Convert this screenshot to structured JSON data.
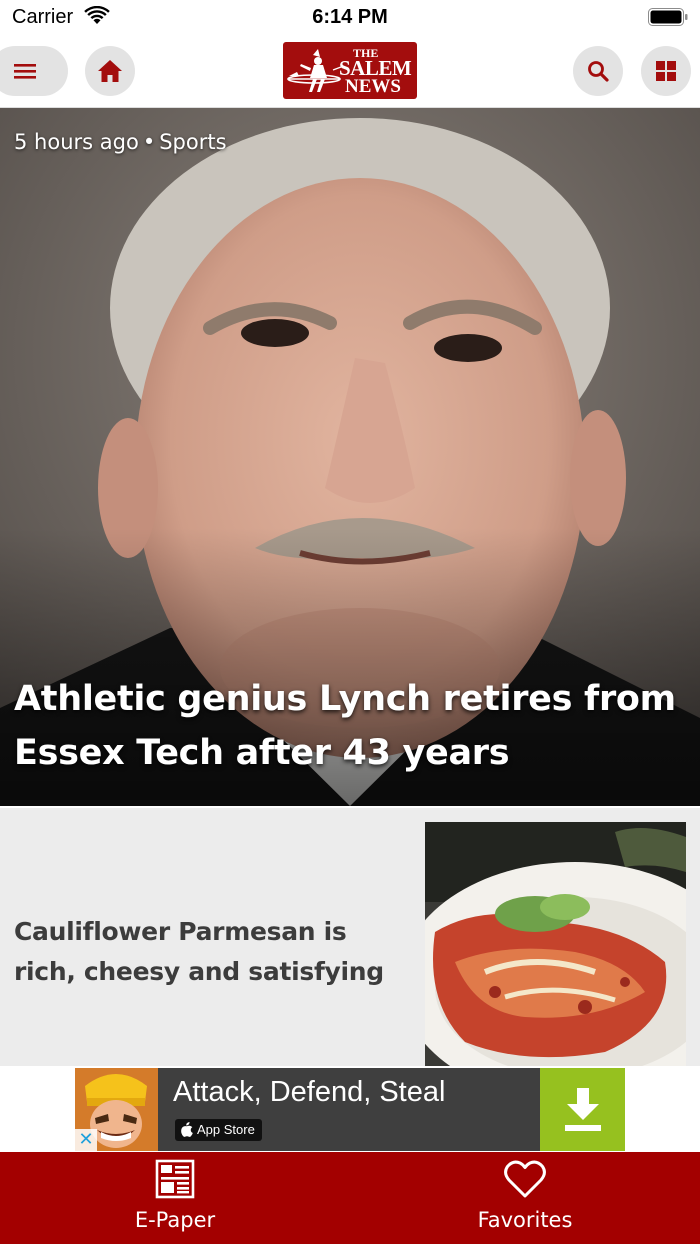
{
  "status_bar": {
    "carrier": "Carrier",
    "time": "6:14 PM"
  },
  "header": {
    "logo": {
      "line1": "THE",
      "line2": "SALEM",
      "line3": "NEWS"
    },
    "icons": {
      "menu": "menu-icon",
      "home": "home-icon",
      "search": "search-icon",
      "sections": "grid-icon"
    }
  },
  "hero": {
    "time_ago": "5 hours ago",
    "separator": "•",
    "section": "Sports",
    "title": "Athletic genius Lynch retires from Essex Tech after 43 years"
  },
  "story": {
    "title": "Cauliflower Parmesan is rich, cheesy and satisfying"
  },
  "ad": {
    "title": "Attack, Defend, Steal",
    "store_badge": "App Store",
    "close_glyph": "✕"
  },
  "tabbar": {
    "items": [
      {
        "label": "E-Paper",
        "icon": "newspaper-icon"
      },
      {
        "label": "Favorites",
        "icon": "heart-icon"
      }
    ]
  },
  "colors": {
    "brand_red": "#a30000",
    "logo_red": "#a30d0d",
    "icon_red": "#a30d0d",
    "button_gray": "#e3e3e3",
    "story_bg": "#ececec",
    "ad_green": "#96c11f"
  }
}
